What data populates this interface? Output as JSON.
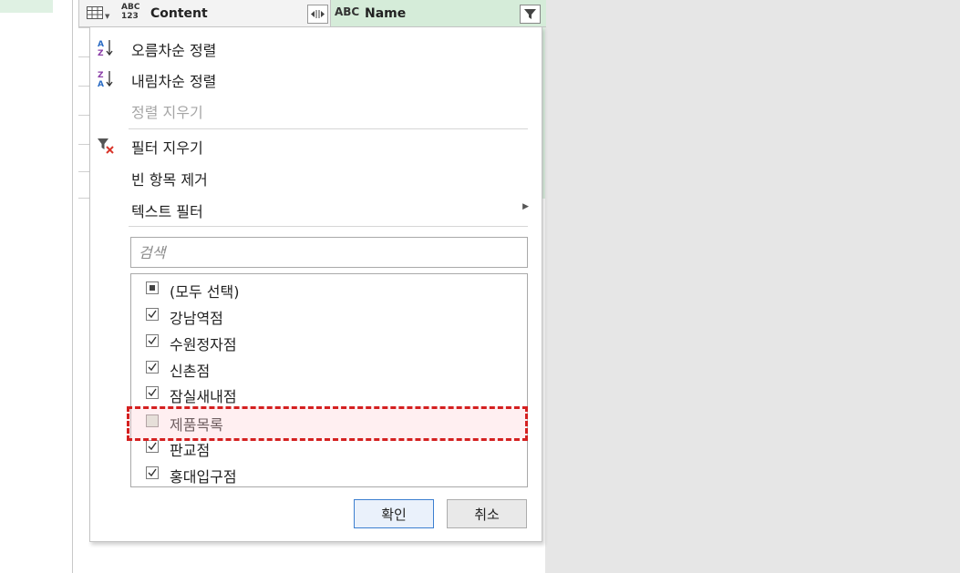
{
  "header": {
    "content_col": {
      "type_badge_top": "ABC",
      "type_badge_bottom": "123",
      "title": "Content"
    },
    "name_col": {
      "type_badge": "ABC",
      "title": "Name"
    }
  },
  "menu": {
    "sort_asc": "오름차순 정렬",
    "sort_desc": "내림차순 정렬",
    "clear_sort": "정렬 지우기",
    "clear_filter": "필터 지우기",
    "remove_empty": "빈 항목 제거",
    "text_filter": "텍스트 필터",
    "search_placeholder": "검색",
    "items": [
      {
        "label": "(모두 선택)",
        "state": "indeterminate"
      },
      {
        "label": "강남역점",
        "state": "checked"
      },
      {
        "label": "수원정자점",
        "state": "checked"
      },
      {
        "label": "신촌점",
        "state": "checked"
      },
      {
        "label": "잠실새내점",
        "state": "checked"
      },
      {
        "label": "제품목록",
        "state": "unchecked"
      },
      {
        "label": "판교점",
        "state": "checked"
      },
      {
        "label": "홍대입구점",
        "state": "checked"
      }
    ],
    "ok": "확인",
    "cancel": "취소"
  },
  "colors": {
    "accent_green": "#d5ecd9",
    "highlight_border": "#d42020",
    "ok_border": "#3c7fd0"
  }
}
